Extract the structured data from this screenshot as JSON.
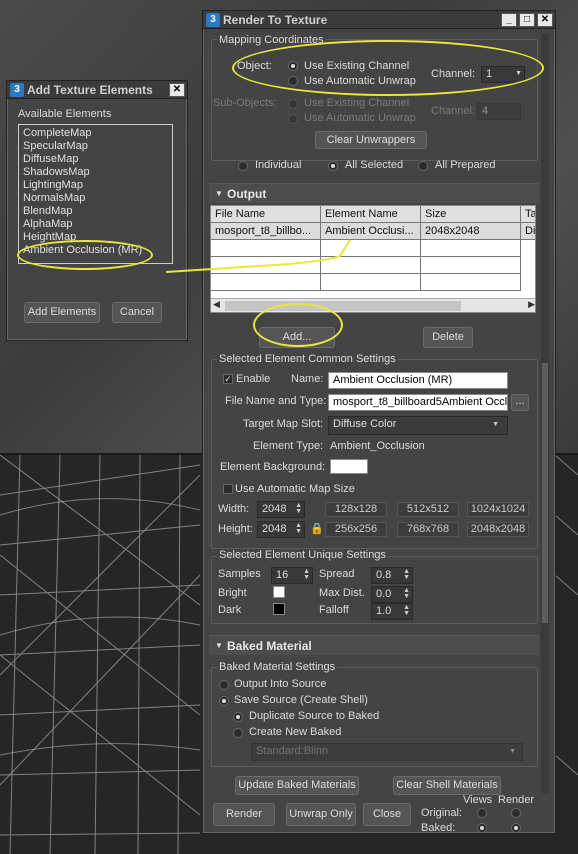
{
  "add_texture": {
    "title": "Add Texture Elements",
    "available_label": "Available Elements",
    "items": [
      "CompleteMap",
      "SpecularMap",
      "DiffuseMap",
      "ShadowsMap",
      "LightingMap",
      "NormalsMap",
      "BlendMap",
      "AlphaMap",
      "HeightMap",
      "Ambient Occlusion (MR)"
    ],
    "add_button": "Add Elements",
    "cancel_button": "Cancel"
  },
  "rtt": {
    "title": "Render To Texture",
    "mapping": {
      "group_label": "Mapping Coordinates",
      "object_label": "Object:",
      "use_existing": "Use Existing Channel",
      "use_auto": "Use Automatic Unwrap",
      "channel_label": "Channel:",
      "channel_value": "1",
      "subobjects_label": "Sub-Objects:",
      "sub_use_existing": "Use Existing Channel",
      "sub_use_auto": "Use Automatic Unwrap",
      "sub_channel_label": "Channel:",
      "sub_channel_value": "4",
      "clear_unwrappers": "Clear Unwrappers",
      "individual": "Individual",
      "all_selected": "All Selected",
      "all_prepared": "All Prepared"
    },
    "output": {
      "section_title": "Output",
      "columns": [
        "File Name",
        "Element Name",
        "Size",
        "Ta"
      ],
      "row": [
        "mosport_t8_billbo...",
        "Ambient Occlusi...",
        "2048x2048",
        "Diff"
      ],
      "add_button": "Add...",
      "delete_button": "Delete"
    },
    "common": {
      "group_label": "Selected Element Common Settings",
      "enable_label": "Enable",
      "name_label": "Name:",
      "name_value": "Ambient Occlusion (MR)",
      "file_label": "File Name and Type:",
      "file_value": "mosport_t8_billboard5Ambient Occl",
      "browse": "...",
      "target_label": "Target Map Slot:",
      "target_value": "Diffuse Color",
      "type_label": "Element Type:",
      "type_value": "Ambient_Occlusion",
      "bg_label": "Element Background:",
      "auto_size_label": "Use Automatic Map Size",
      "width_label": "Width:",
      "width_value": "2048",
      "height_label": "Height:",
      "height_value": "2048",
      "presets": [
        "128x128",
        "512x512",
        "1024x1024",
        "256x256",
        "768x768",
        "2048x2048"
      ]
    },
    "unique": {
      "group_label": "Selected Element Unique Settings",
      "samples_label": "Samples",
      "samples_value": "16",
      "spread_label": "Spread",
      "spread_value": "0.8",
      "bright_label": "Bright",
      "maxdist_label": "Max Dist.",
      "maxdist_value": "0.0",
      "dark_label": "Dark",
      "falloff_label": "Falloff",
      "falloff_value": "1.0"
    },
    "baked": {
      "section_title": "Baked Material",
      "group_label": "Baked Material Settings",
      "output_into": "Output Into Source",
      "save_source": "Save Source (Create Shell)",
      "duplicate": "Duplicate Source to Baked",
      "create_new": "Create New Baked",
      "material_value": "Standard:Blinn",
      "update_button": "Update Baked Materials",
      "clear_shell_button": "Clear Shell Materials"
    },
    "footer": {
      "render": "Render",
      "unwrap_only": "Unwrap Only",
      "close": "Close",
      "views": "Views",
      "render_col": "Render",
      "original": "Original:",
      "baked": "Baked:"
    }
  },
  "colors": {
    "highlight": "#e8e83a",
    "panel": "#444444",
    "selected_row": "#dcdcdc"
  }
}
